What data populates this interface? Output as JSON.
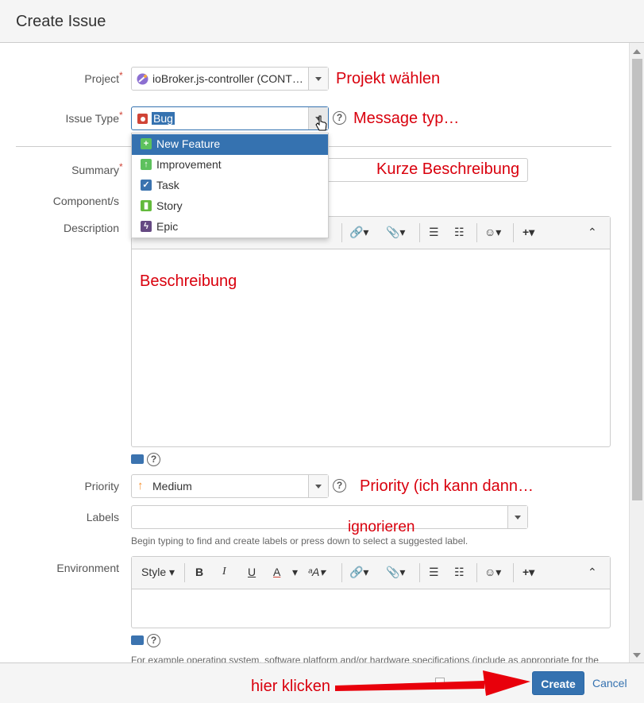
{
  "dialog": {
    "title": "Create Issue"
  },
  "project": {
    "label": "Project",
    "value": "ioBroker.js-controller (CONT…",
    "note": "Projekt wählen"
  },
  "issue_type": {
    "label": "Issue Type",
    "value": "Bug",
    "note": "Message typ…",
    "options": [
      {
        "label": "New Feature",
        "icon": "plus-icon",
        "color": "#5dc15d"
      },
      {
        "label": "Improvement",
        "icon": "arrow-up-icon",
        "color": "#5dc15d"
      },
      {
        "label": "Task",
        "icon": "check-icon",
        "color": "#3b73af"
      },
      {
        "label": "Story",
        "icon": "bookmark-icon",
        "color": "#63ba3c"
      },
      {
        "label": "Epic",
        "icon": "lightning-icon",
        "color": "#654982"
      }
    ]
  },
  "summary": {
    "label": "Summary",
    "note": "Kurze Beschreibung"
  },
  "component": {
    "label": "Component/s"
  },
  "description": {
    "label": "Description",
    "note": "Beschreibung"
  },
  "priority": {
    "label": "Priority",
    "value": "Medium",
    "note": "Priority (ich kann dann…"
  },
  "labels": {
    "label": "Labels",
    "note": "ignorieren",
    "hint": "Begin typing to find and create labels or press down to select a suggested label."
  },
  "environment": {
    "label": "Environment",
    "toolbar_style": "Style",
    "hint": "For example operating system, software platform and/or hardware specifications (include as appropriate for the"
  },
  "footer": {
    "note": "hier klicken",
    "create": "Create",
    "cancel": "Cancel",
    "arrow_color": "#e8000b"
  },
  "colors": {
    "accent": "#3572b0",
    "required": "#d04437",
    "annotation": "#d9000d",
    "bug": "#d04437"
  }
}
